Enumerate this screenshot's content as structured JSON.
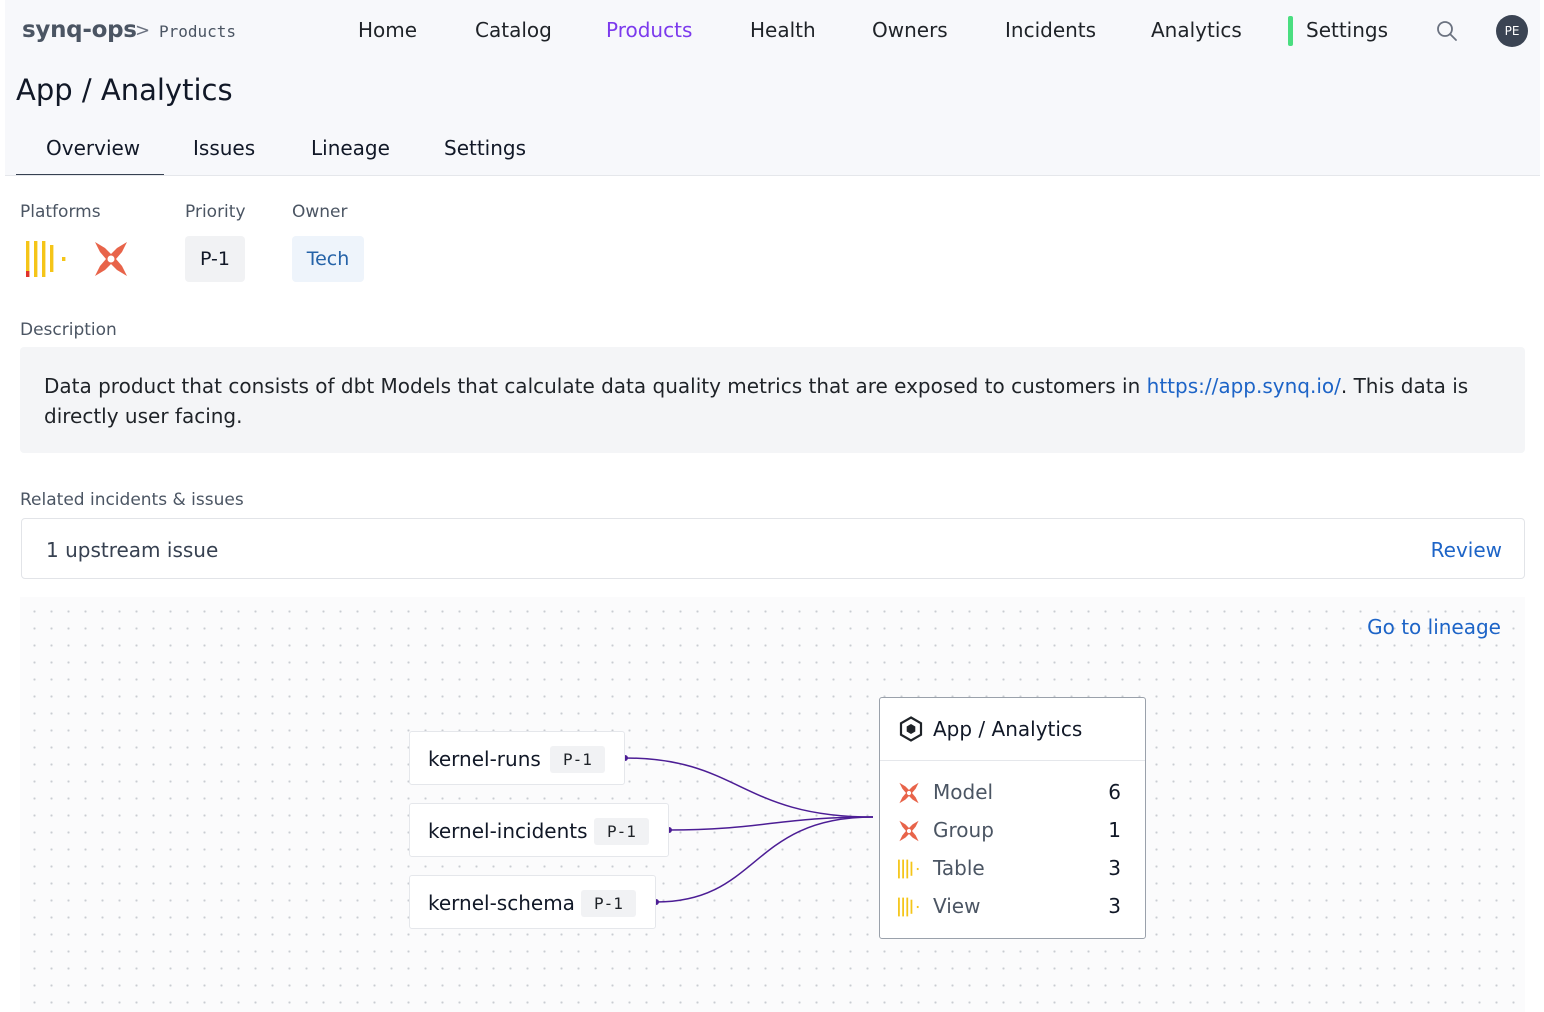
{
  "header": {
    "brand": "synq-ops",
    "breadcrumb_sep": ">",
    "breadcrumb": "Products",
    "nav": [
      {
        "label": "Home",
        "active": false
      },
      {
        "label": "Catalog",
        "active": false
      },
      {
        "label": "Products",
        "active": true
      },
      {
        "label": "Health",
        "active": false
      },
      {
        "label": "Owners",
        "active": false
      },
      {
        "label": "Incidents",
        "active": false
      },
      {
        "label": "Analytics",
        "active": false
      },
      {
        "label": "Settings",
        "active": false
      }
    ],
    "search_icon": "search-icon",
    "avatar_initials": "PE"
  },
  "page_title": "App / Analytics",
  "tabs": [
    {
      "label": "Overview",
      "active": true
    },
    {
      "label": "Issues",
      "active": false
    },
    {
      "label": "Lineage",
      "active": false
    },
    {
      "label": "Settings",
      "active": false
    }
  ],
  "meta": {
    "platforms_label": "Platforms",
    "platforms": [
      "bigquery-bars-icon",
      "dbt-icon"
    ],
    "priority_label": "Priority",
    "priority_value": "P-1",
    "owner_label": "Owner",
    "owner_value": "Tech"
  },
  "description": {
    "label": "Description",
    "text_before": "Data product that consists of dbt Models that calculate data quality metrics that are exposed to customers in ",
    "link": "https://app.synq.io/",
    "text_after": ". This data is directly user facing."
  },
  "incidents": {
    "label": "Related incidents & issues",
    "summary": "1 upstream issue",
    "review_label": "Review"
  },
  "lineage": {
    "go_label": "Go to lineage",
    "upstream": [
      {
        "name": "kernel-runs",
        "priority": "P-1"
      },
      {
        "name": "kernel-incidents",
        "priority": "P-1"
      },
      {
        "name": "kernel-schema",
        "priority": "P-1"
      }
    ],
    "product": {
      "title": "App / Analytics",
      "icon": "hexagon-icon",
      "rows": [
        {
          "label": "Model",
          "count": "6",
          "icon": "dbt-icon"
        },
        {
          "label": "Group",
          "count": "1",
          "icon": "dbt-icon"
        },
        {
          "label": "Table",
          "count": "3",
          "icon": "bigquery-bars-icon"
        },
        {
          "label": "View",
          "count": "3",
          "icon": "bigquery-bars-icon"
        }
      ]
    }
  },
  "colors": {
    "accent": "#7c3aed",
    "link": "#1d64c7",
    "edge": "#4c1d95",
    "dbt": "#e8644a",
    "bars": "#f5c518",
    "settings_marker": "#4ade80"
  }
}
